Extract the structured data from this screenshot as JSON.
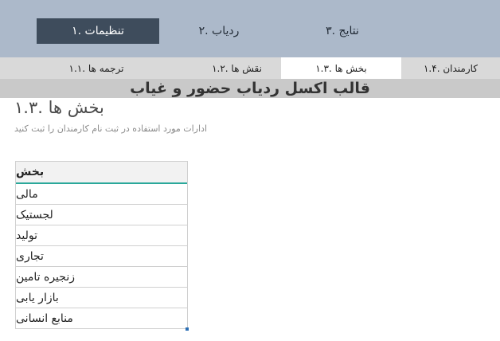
{
  "topnav": {
    "tabs": [
      {
        "label": "تنظیمات .۱",
        "active": true
      },
      {
        "label": "ردیاب .۲",
        "active": false
      },
      {
        "label": "نتایج .۳",
        "active": false
      }
    ]
  },
  "subnav": {
    "tabs": [
      {
        "label": "ترجمه ها .۱.۱",
        "active": false
      },
      {
        "label": "نقش ها .۱.۲",
        "active": false
      },
      {
        "label": "بخش ها .۱.۳",
        "active": true
      },
      {
        "label": "کارمندان .۱.۴",
        "active": false
      }
    ]
  },
  "banner": {
    "title": "قالب اکسل ردیاب حضور و غیاب"
  },
  "section": {
    "title": "بخش ها .۱.۳",
    "description": "ادارات مورد استفاده در ثبت نام کارمندان را ثبت کنید"
  },
  "table": {
    "header": "بخش",
    "rows": [
      "مالی",
      "لجستیک",
      "تولید",
      "تجاری",
      "زنجیره تامین",
      "بازار یابی",
      "منابع انسانی"
    ]
  },
  "colors": {
    "topnav_bg": "#acb9ca",
    "active_tab_bg": "#3e4c5c",
    "subnav_bg": "#d9d9d9",
    "banner_bg": "#c9c9c9",
    "table_accent": "#2aa89a"
  }
}
